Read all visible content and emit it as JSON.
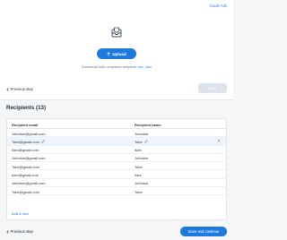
{
  "header": {
    "guide_link": "Guide Ads"
  },
  "upload": {
    "button_label": "Upload",
    "hint_prefix": "Download bulk recipients template: ",
    "hint_formats": "csv, xlsx"
  },
  "nav_top": {
    "previous_label": "Previous step",
    "next_label": "Next"
  },
  "recipients": {
    "title": "Recipients (13)",
    "columns": {
      "email": "Recipient email",
      "name": "Recipient name"
    },
    "rows": [
      {
        "email": "Johndoe@gmail.com",
        "name": "Johndoe"
      },
      {
        "email": "Tobe@gmail.com",
        "name": "Tobe"
      },
      {
        "email": "Alex@gmail.com",
        "name": "Alex"
      },
      {
        "email": "Johndoe@gmail.com",
        "name": "Johndoe"
      },
      {
        "email": "Tobe@gmail.com",
        "name": "Tobe"
      },
      {
        "email": "Alex@gmail.com",
        "name": "Alex"
      },
      {
        "email": "Johndoe@gmail.com",
        "name": "Johndoe"
      },
      {
        "email": "Tobe@gmail.com",
        "name": "Tobe"
      }
    ],
    "add_new": "Add a new"
  },
  "nav_bottom": {
    "previous_label": "Previous step",
    "save_label": "Save and continue"
  },
  "colors": {
    "accent": "#1f7ae0",
    "link": "#2f80ed",
    "highlight_row": "#eef4fb"
  }
}
